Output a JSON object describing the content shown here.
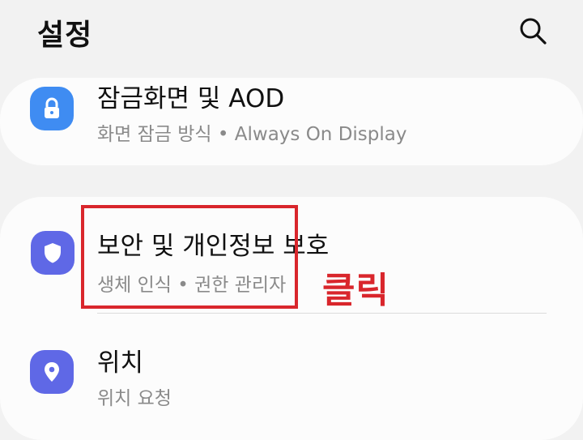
{
  "header": {
    "title": "설정",
    "search_icon": "search-icon"
  },
  "items": [
    {
      "title": "잠금화면 및 AOD",
      "subtitle": "화면 잠금 방식  •  Always On Display",
      "icon": "lock-icon",
      "icon_color": "#3f8cf2"
    },
    {
      "title": "보안 및 개인정보 보호",
      "subtitle": "생체 인식  •  권한 관리자",
      "icon": "shield-icon",
      "icon_color": "#5f68e6"
    },
    {
      "title": "위치",
      "subtitle": "위치 요청",
      "icon": "location-pin-icon",
      "icon_color": "#5f68e6"
    }
  ],
  "annotation": {
    "label": "클릭",
    "color": "#d9262c"
  }
}
